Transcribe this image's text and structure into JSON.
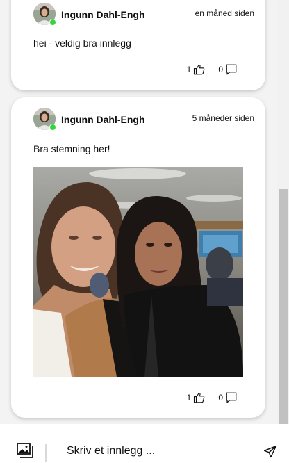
{
  "posts": [
    {
      "author": "Ingunn Dahl-Engh",
      "time": "en måned siden",
      "text": "hei - veldig bra innlegg",
      "likes": "1",
      "comments": "0",
      "avatar_icon": "user-avatar-icon",
      "online_status_color": "#35d43a"
    },
    {
      "author": "Ingunn Dahl-Engh",
      "time": "5 måneder siden",
      "text": "Bra stemning her!",
      "likes": "1",
      "comments": "0",
      "avatar_icon": "user-avatar-icon",
      "has_photo": true
    }
  ],
  "composer": {
    "placeholder": "Skriv et innlegg ...",
    "gallery_icon": "image-gallery-icon",
    "send_icon": "send-icon"
  },
  "icons": {
    "like": "thumbs-up-icon",
    "comment": "comment-bubble-icon"
  }
}
